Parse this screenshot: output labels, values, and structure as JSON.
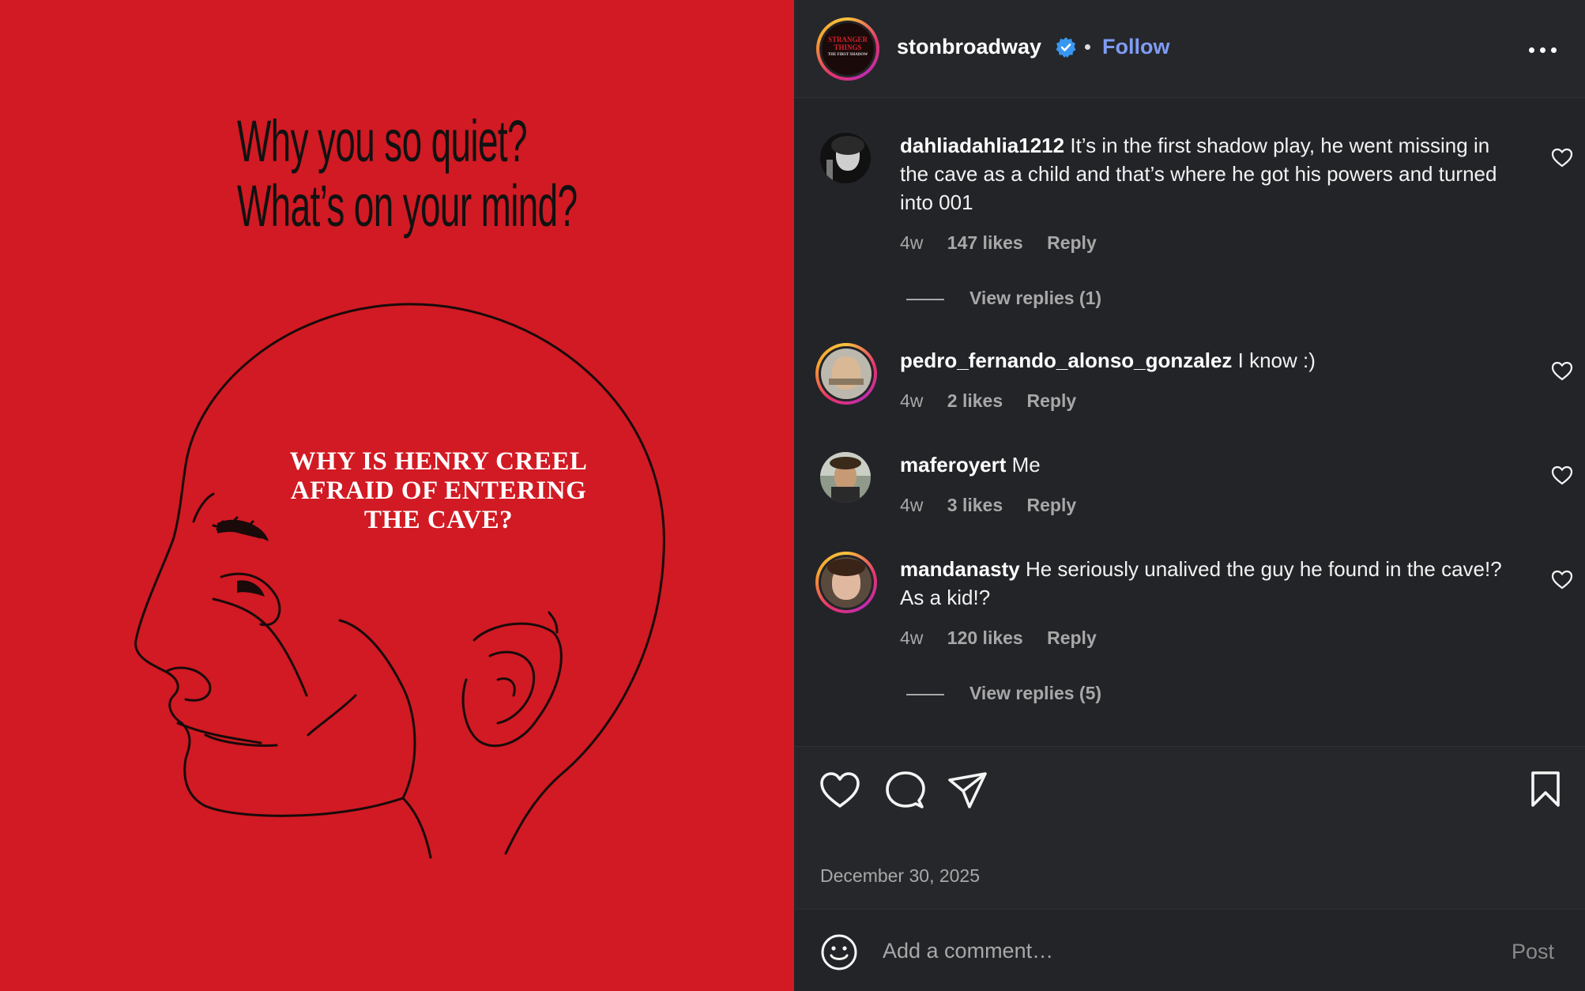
{
  "post_image": {
    "headline_line1": "Why you so quiet?",
    "headline_line2": "What’s on your mind?",
    "question": "WHY IS HENRY CREEL AFRAID OF ENTERING THE CAVE?"
  },
  "header": {
    "username": "stonbroadway",
    "follow_label": "Follow",
    "avatar_text_line1": "STRANGER",
    "avatar_text_line2": "THINGS",
    "avatar_text_line3": "THE FIRST SHADOW"
  },
  "comments": [
    {
      "username": "dahliadahlia1212",
      "text": "It’s in the first shadow play, he went missing in the cave as a child and that’s where he got his powers and turned into 001",
      "time": "4w",
      "likes": "147 likes",
      "reply_label": "Reply",
      "view_replies": "View replies (1)"
    },
    {
      "username": "pedro_fernando_alonso_gonzalez",
      "text": "I know :)",
      "time": "4w",
      "likes": "2 likes",
      "reply_label": "Reply"
    },
    {
      "username": "maferoyert",
      "text": "Me",
      "time": "4w",
      "likes": "3 likes",
      "reply_label": "Reply"
    },
    {
      "username": "mandanasty",
      "text": "He seriously unalived the guy he found in the cave!? As a kid!?",
      "time": "4w",
      "likes": "120 likes",
      "reply_label": "Reply",
      "view_replies": "View replies (5)"
    }
  ],
  "footer": {
    "date": "December 30, 2025",
    "comment_placeholder": "Add a comment…",
    "post_label": "Post"
  },
  "icons": {
    "like": "heart-icon",
    "comment": "comment-bubble-icon",
    "share": "paper-plane-icon",
    "save": "bookmark-icon",
    "emoji": "smiley-icon",
    "more": "more-options-icon",
    "verified": "verified-badge-icon"
  },
  "colors": {
    "poster_red": "#d11a23",
    "panel_bg": "#232428",
    "follow_blue": "#7f9cf5",
    "verified_blue": "#3897f0"
  }
}
